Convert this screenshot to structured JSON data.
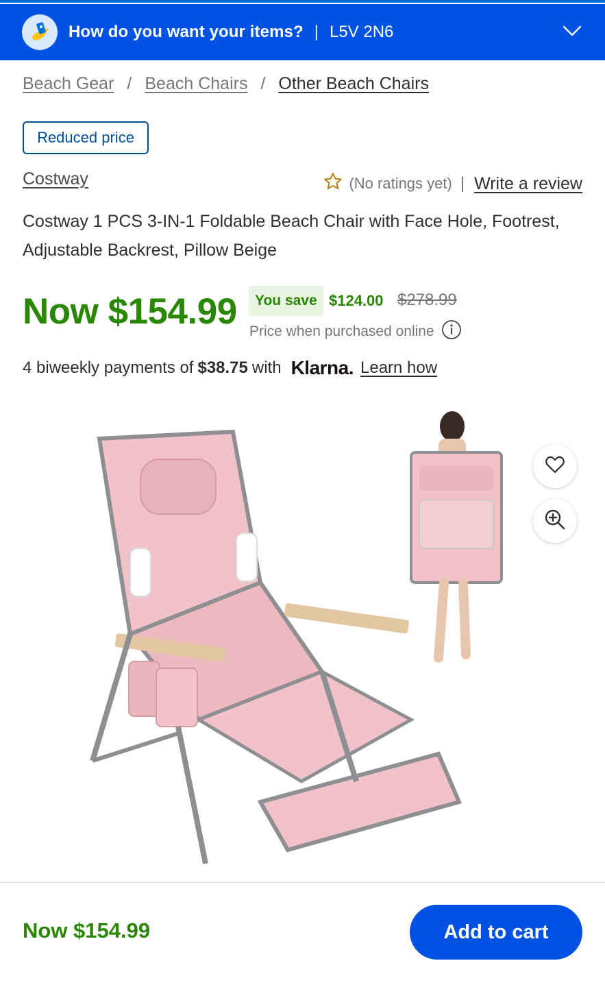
{
  "header": {
    "title": "How do you want your items?",
    "separator": "|",
    "postal_code": "L5V 2N6",
    "icon": "delivery-hand-icon",
    "chevron_icon": "chevron-down-icon",
    "color": "#0053e2"
  },
  "breadcrumb": {
    "items": [
      "Beach Gear",
      "Beach Chairs",
      "Other Beach Chairs"
    ],
    "separator": "/"
  },
  "badge": {
    "label": "Reduced price"
  },
  "brand": {
    "name": "Costway"
  },
  "rating": {
    "icon": "star-outline-icon",
    "text": "(No ratings yet)",
    "separator": "|",
    "write_review": "Write a review"
  },
  "product": {
    "title": "Costway 1 PCS 3-IN-1 Foldable Beach Chair with Face Hole, Footrest, Adjustable Backrest, Pillow Beige"
  },
  "price": {
    "now": "Now $154.99",
    "you_save_label": "You save",
    "save_amount": "$124.00",
    "was": "$278.99",
    "online_note": "Price when purchased online",
    "color": "#2a8703"
  },
  "klarna": {
    "prefix": "4 biweekly payments of",
    "amount": "$38.75",
    "with": "with",
    "logo": "Klarna.",
    "learn": "Learn how"
  },
  "media": {
    "image_label": "pink folding beach chair",
    "favorite_icon": "heart-icon",
    "zoom_icon": "zoom-in-icon"
  },
  "footer": {
    "price": "Now $154.99",
    "add_to_cart": "Add to cart"
  }
}
